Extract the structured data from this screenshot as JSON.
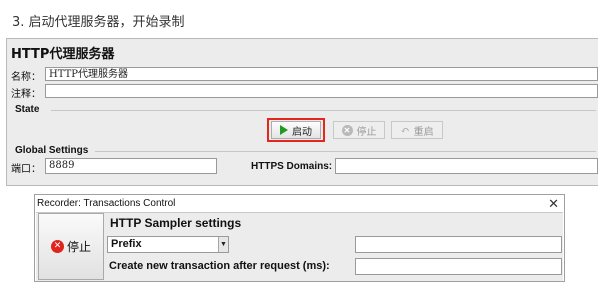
{
  "step_title": "3. 启动代理服务器，开始录制",
  "panel": {
    "title": "HTTP代理服务器",
    "name_label": "名称：",
    "name_value": "HTTP代理服务器",
    "comment_label": "注释：",
    "comment_value": "",
    "state_title": "State",
    "start_label": "启动",
    "stop_label": "停止",
    "restart_label": "重启",
    "global_title": "Global Settings",
    "port_label": "端口：",
    "port_value": "8889",
    "https_label": "HTTPS Domains:",
    "https_value": ""
  },
  "dialog": {
    "title": "Recorder: Transactions Control",
    "close_glyph": "✕",
    "stop_label": "停止",
    "sampler_title": "HTTP Sampler settings",
    "prefix_value": "Prefix",
    "prefix_text_value": "",
    "transaction_label": "Create new transaction after request (ms):",
    "transaction_value": ""
  },
  "colors": {
    "highlight": "#e3271d",
    "start_icon": "#1f9b23",
    "stop_icon": "#e0231b"
  },
  "icons": [
    "play-icon",
    "stop-icon",
    "restart-icon",
    "close-icon",
    "dropdown-arrow-icon"
  ]
}
